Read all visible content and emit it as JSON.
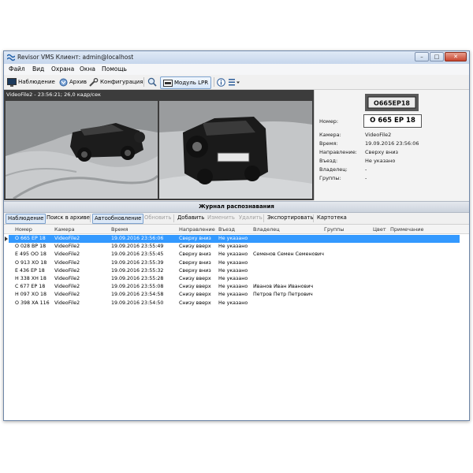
{
  "window": {
    "title": "Revisor VMS Клиент: admin@localhost",
    "buttons": {
      "minimize": "–",
      "maximize": "□",
      "close": "✕"
    }
  },
  "menu": [
    "Файл",
    "Вид",
    "Охрана",
    "Окна",
    "Помощь"
  ],
  "toolbar": {
    "monitor": "Наблюдение",
    "archive": "Архив",
    "config": "Конфигурация",
    "lpr": "Модуль LPR"
  },
  "video": {
    "label": "VideoFile2 - 23:56:21; 26,0 кадр/сек",
    "plate_crop_text": "О665ЕР18"
  },
  "info": {
    "plate": "О 665 ЕР 18",
    "labels": {
      "number": "Номер:",
      "camera": "Камера:",
      "time": "Время:",
      "direction": "Направление:",
      "entry": "Въезд:",
      "owner": "Владелец:",
      "groups": "Группы:"
    },
    "values": {
      "camera": "VideoFile2",
      "time": "19.09.2016 23:56:06",
      "direction": "Сверху вниз",
      "entry": "Не указано",
      "owner": "-",
      "groups": "-"
    }
  },
  "journal": {
    "title": "Журнал распознавания",
    "buttons": {
      "monitor": "Наблюдение",
      "archive_search": "Поиск в архиве",
      "autoupdate": "Автообновление",
      "refresh": "Обновить",
      "add": "Добавить",
      "edit": "Изменить",
      "delete": "Удалить",
      "export": "Экспортировать",
      "cards": "Картотека"
    },
    "columns": [
      "Номер",
      "Камера",
      "Время",
      "Направление",
      "Въезд",
      "Владелец",
      "Группы",
      "Цвет",
      "Примечание"
    ],
    "rows": [
      [
        "О 665 ЕР 18",
        "VideoFile2",
        "19.09.2016 23:56:06",
        "Сверху вниз",
        "Не указано",
        "",
        "",
        "",
        ""
      ],
      [
        "О 028 ВР 18",
        "VideoFile2",
        "19.09.2016 23:55:49",
        "Снизу вверх",
        "Не указано",
        "",
        "",
        "",
        ""
      ],
      [
        "Е 495 ОО 18",
        "VideoFile2",
        "19.09.2016 23:55:45",
        "Сверху вниз",
        "Не указано",
        "Семенов Семен Семенович",
        "",
        "",
        ""
      ],
      [
        "О 913 ХО 18",
        "VideoFile2",
        "19.09.2016 23:55:39",
        "Сверху вниз",
        "Не указано",
        "",
        "",
        "",
        ""
      ],
      [
        "Е 436 ЕР 18",
        "VideoFile2",
        "19.09.2016 23:55:32",
        "Сверху вниз",
        "Не указано",
        "",
        "",
        "",
        ""
      ],
      [
        "Н 338 ХН 18",
        "VideoFile2",
        "19.09.2016 23:55:28",
        "Снизу вверх",
        "Не указано",
        "",
        "",
        "",
        ""
      ],
      [
        "С 677 ЕР 18",
        "VideoFile2",
        "19.09.2016 23:55:08",
        "Снизу вверх",
        "Не указано",
        "Иванов Иван Иванович",
        "",
        "",
        ""
      ],
      [
        "Н 097 ХО 18",
        "VideoFile2",
        "19.09.2016 23:54:58",
        "Снизу вверх",
        "Не указано",
        "Петров Петр Петрович",
        "",
        "",
        ""
      ],
      [
        "О 398 ХА 116",
        "VideoFile2",
        "19.09.2016 23:54:50",
        "Снизу вверх",
        "Не указано",
        "",
        "",
        "",
        ""
      ]
    ]
  },
  "colors": {
    "selection": "#3399ff",
    "accent": "#7da2ce"
  }
}
